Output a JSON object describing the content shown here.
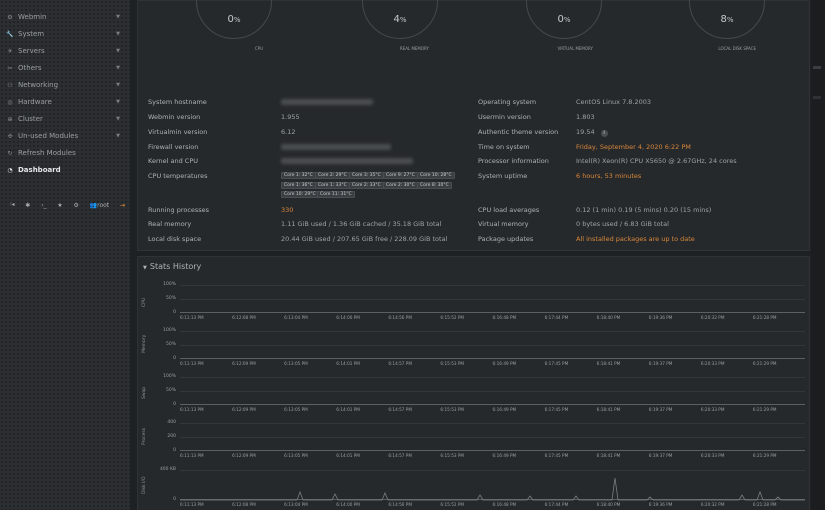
{
  "sidebar": {
    "items": [
      {
        "label": "Webmin",
        "icon": "gear-icon",
        "has_arrow": true
      },
      {
        "label": "System",
        "icon": "wrench-icon",
        "has_arrow": true
      },
      {
        "label": "Servers",
        "icon": "rocket-icon",
        "has_arrow": true
      },
      {
        "label": "Others",
        "icon": "tools-icon",
        "has_arrow": true
      },
      {
        "label": "Networking",
        "icon": "network-icon",
        "has_arrow": true
      },
      {
        "label": "Hardware",
        "icon": "hardware-icon",
        "has_arrow": true
      },
      {
        "label": "Cluster",
        "icon": "cluster-icon",
        "has_arrow": true
      },
      {
        "label": "Un-used Modules",
        "icon": "puzzle-icon",
        "has_arrow": true
      },
      {
        "label": "Refresh Modules",
        "icon": "refresh-icon",
        "has_arrow": false
      },
      {
        "label": "Dashboard",
        "icon": "dashboard-icon",
        "has_arrow": false,
        "active": true
      }
    ],
    "tools": {
      "user_label": "root"
    }
  },
  "gauges": [
    {
      "value": "0",
      "unit": "%",
      "label": "CPU"
    },
    {
      "value": "4",
      "unit": "%",
      "label": "REAL MEMORY"
    },
    {
      "value": "0",
      "unit": "%",
      "label": "VIRTUAL MEMORY"
    },
    {
      "value": "8",
      "unit": "%",
      "label": "LOCAL DISK SPACE"
    }
  ],
  "info_left": [
    {
      "label": "System hostname",
      "value": ""
    },
    {
      "label": "Webmin version",
      "value": "1.955"
    },
    {
      "label": "Virtualmin version",
      "value": "6.12"
    },
    {
      "label": "Firewall version",
      "value": ""
    },
    {
      "label": "Kernel and CPU",
      "value": ""
    },
    {
      "label": "CPU temperatures",
      "value": ""
    },
    {
      "label": "Running processes",
      "value": "330"
    },
    {
      "label": "Real memory",
      "value": "1.11 GiB used / 1.36 GiB cached / 35.18 GiB total"
    },
    {
      "label": "Local disk space",
      "value": "20.44 GiB used / 207.65 GiB free / 228.09 GiB total"
    }
  ],
  "info_right": [
    {
      "label": "Operating system",
      "value": "CentOS Linux 7.8.2003"
    },
    {
      "label": "Usermin version",
      "value": "1.803"
    },
    {
      "label": "Authentic theme version",
      "value": "19.54"
    },
    {
      "label": "Time on system",
      "value": "Friday, September 4, 2020 6:22 PM"
    },
    {
      "label": "Processor information",
      "value": "Intel(R) Xeon(R) CPU X5650 @ 2.67GHz, 24 cores"
    },
    {
      "label": "System uptime",
      "value": "6 hours, 53 minutes"
    },
    {
      "label": "CPU load averages",
      "value": "0.12 (1 min) 0.19 (5 mins) 0.20 (15 mins)"
    },
    {
      "label": "Virtual memory",
      "value": "0 bytes used / 6.83 GiB total"
    },
    {
      "label": "Package updates",
      "value": "All installed packages are up to date"
    }
  ],
  "cpu_temps": [
    "Core 1: 32°C",
    "Core 2: 29°C",
    "Core 3: 35°C",
    "Core 9: 27°C",
    "Core 10: 28°C",
    "Core 1: 36°C",
    "Core 1: 33°C",
    "Core 2: 33°C",
    "Core 2: 30°C",
    "Core 8: 30°C",
    "Core 10: 29°C",
    "Core 11: 31°C"
  ],
  "stats": {
    "title": "Stats History",
    "x_ticks_a": [
      "6:11:13 PM",
      "6:12:08 PM",
      "6:13:04 PM",
      "6:14:00 PM",
      "6:14:56 PM",
      "6:15:52 PM",
      "6:16:48 PM",
      "6:17:44 PM",
      "6:18:40 PM",
      "6:19:36 PM",
      "6:20:32 PM",
      "6:21:28 PM"
    ],
    "x_ticks_b": [
      "6:11:13 PM",
      "6:12:09 PM",
      "6:13:05 PM",
      "6:14:01 PM",
      "6:14:57 PM",
      "6:15:53 PM",
      "6:16:49 PM",
      "6:17:45 PM",
      "6:18:41 PM",
      "6:19:37 PM",
      "6:20:33 PM",
      "6:21:29 PM"
    ],
    "charts": [
      {
        "title": "CPU",
        "y_ticks": [
          "100%",
          "50%",
          "0"
        ],
        "ticks_set": "a"
      },
      {
        "title": "Memory",
        "y_ticks": [
          "100%",
          "50%",
          "0"
        ],
        "ticks_set": "b"
      },
      {
        "title": "Swap",
        "y_ticks": [
          "100%",
          "50%",
          "0"
        ],
        "ticks_set": "b"
      },
      {
        "title": "Process",
        "y_ticks": [
          "400",
          "200",
          "0"
        ],
        "ticks_set": "b"
      },
      {
        "title": "Disk I/O",
        "y_ticks": [
          "400 KB",
          "0"
        ],
        "ticks_set": "a2"
      }
    ],
    "x_ticks_a2": [
      "6:11:13 PM",
      "6:12:08 PM",
      "6:13:04 PM",
      "6:14:00 PM",
      "6:14:56 PM",
      "6:15:52 PM",
      "6:16:48 PM",
      "6:17:44 PM",
      "6:18:40 PM",
      "6:19:36 PM",
      "6:20:32 PM",
      "6:21:28 PM"
    ]
  },
  "colors": {
    "accent": "#d8873a",
    "panel": "#26292c",
    "background": "#1e2124"
  }
}
